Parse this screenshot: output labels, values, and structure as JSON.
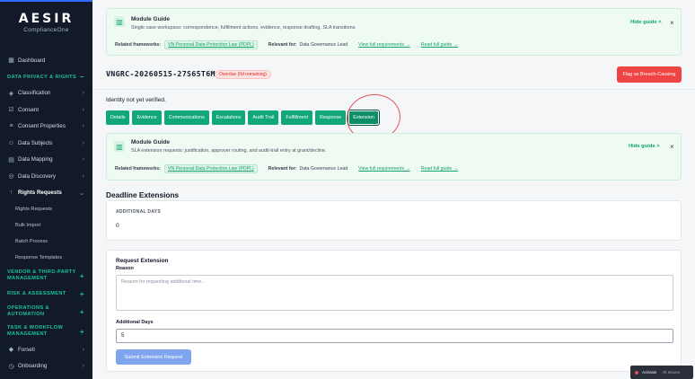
{
  "brand": {
    "name": "AESIR",
    "sub": "ComplianceOne"
  },
  "sidebar": {
    "items": [
      {
        "kind": "item",
        "label": "Dashboard",
        "icon": "grid-icon",
        "icon_glyph": "▦",
        "chev": ""
      },
      {
        "kind": "section",
        "label": "DATA PRIVACY & RIGHTS",
        "action": "−"
      },
      {
        "kind": "item",
        "label": "Classification",
        "icon": "tag-icon",
        "icon_glyph": "◈",
        "chev": "›"
      },
      {
        "kind": "item",
        "label": "Consent",
        "icon": "check-icon",
        "icon_glyph": "☑",
        "chev": "›"
      },
      {
        "kind": "item",
        "label": "Consent Properties",
        "icon": "sliders-icon",
        "icon_glyph": "≡",
        "chev": "›"
      },
      {
        "kind": "item",
        "label": "Data Subjects",
        "icon": "users-icon",
        "icon_glyph": "☺",
        "chev": "›"
      },
      {
        "kind": "item",
        "label": "Data Mapping",
        "icon": "map-icon",
        "icon_glyph": "▤",
        "chev": "›"
      },
      {
        "kind": "item",
        "label": "Data Discovery",
        "icon": "search-icon",
        "icon_glyph": "◎",
        "chev": "›"
      },
      {
        "kind": "item",
        "label": "Rights Requests",
        "icon": "arrow-up-icon",
        "icon_glyph": "↑",
        "chev": "⌄",
        "active": true
      },
      {
        "kind": "sub",
        "label": "Rights Requests"
      },
      {
        "kind": "sub",
        "label": "Bulk Import"
      },
      {
        "kind": "sub",
        "label": "Batch Process"
      },
      {
        "kind": "sub",
        "label": "Response Templates"
      },
      {
        "kind": "section2",
        "label": "VENDOR & THIRD-PARTY MANAGEMENT",
        "action": "+"
      },
      {
        "kind": "section",
        "label": "RISK & ASSESSMENT",
        "action": "+"
      },
      {
        "kind": "section2",
        "label": "OPERATIONS & AUTOMATION",
        "action": "+"
      },
      {
        "kind": "section2",
        "label": "TASK & WORKFLOW MANAGEMENT",
        "action": "+"
      },
      {
        "kind": "item",
        "label": "Forseti",
        "icon": "shield-icon",
        "icon_glyph": "◆",
        "chev": "›"
      },
      {
        "kind": "item",
        "label": "Onboarding",
        "icon": "clock-icon",
        "icon_glyph": "◷",
        "chev": "›"
      }
    ]
  },
  "guide_top": {
    "title": "Module Guide",
    "desc": "Single case workspace: correspondence, fulfillment actions, evidence, response drafting, SLA transitions.",
    "frameworks_label": "Related frameworks:",
    "framework_tag": "VN Personal Data Protection Law (PDPL)",
    "relevant_label": "Relevant for:",
    "relevant_value": "Data Governance Lead",
    "view_full": "View full requirements →",
    "read_full": "Read full guide →",
    "hide_label": "Hide guide ˄",
    "close": "×"
  },
  "request": {
    "id": "VNGRC-20260515-27S65T6M",
    "overdue": "Overdue (0d remaining)",
    "flag_button": "Flag as Breach-Causing",
    "identity": "Identity not yet verified."
  },
  "tabs": [
    "Details",
    "Evidence",
    "Communications",
    "Escalations",
    "Audit Trail",
    "Fulfillment",
    "Response",
    "Extension"
  ],
  "active_tab": "Extension",
  "guide_bottom": {
    "title": "Module Guide",
    "desc": "SLA extension requests: justification, approver routing, and audit-trail entry at grant/decline.",
    "frameworks_label": "Related frameworks:",
    "framework_tag": "VN Personal Data Protection Law (PDPL)",
    "relevant_label": "Relevant for:",
    "relevant_value": "Data Governance Lead",
    "view_full": "View full requirements →",
    "read_full": "Read full guide →",
    "hide_label": "Hide guide ˄",
    "close": "×"
  },
  "deadline": {
    "title": "Deadline Extensions",
    "additional_days_label": "ADDITIONAL DAYS",
    "additional_days_value": "0"
  },
  "extension_form": {
    "title": "Request Extension",
    "reason_label": "Reason",
    "reason_placeholder": "Reason for requesting additional time...",
    "days_label": "Additional Days",
    "days_value": "5",
    "submit": "Submit Extension Request"
  },
  "activate": {
    "label": "Activate",
    "sub": "All Issues"
  },
  "colors": {
    "accent": "#12a77a",
    "danger": "#ef4444",
    "sidebar": "#121a2a",
    "link": "#11a36b"
  }
}
